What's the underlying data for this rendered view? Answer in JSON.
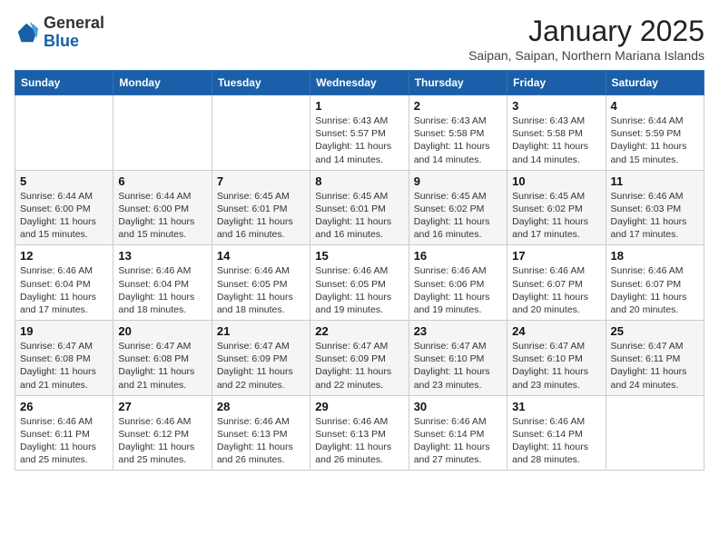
{
  "header": {
    "logo": {
      "general": "General",
      "blue": "Blue"
    },
    "month": "January 2025",
    "location": "Saipan, Saipan, Northern Mariana Islands"
  },
  "weekdays": [
    "Sunday",
    "Monday",
    "Tuesday",
    "Wednesday",
    "Thursday",
    "Friday",
    "Saturday"
  ],
  "weeks": [
    [
      {
        "day": "",
        "sunrise": "",
        "sunset": "",
        "daylight": ""
      },
      {
        "day": "",
        "sunrise": "",
        "sunset": "",
        "daylight": ""
      },
      {
        "day": "",
        "sunrise": "",
        "sunset": "",
        "daylight": ""
      },
      {
        "day": "1",
        "sunrise": "Sunrise: 6:43 AM",
        "sunset": "Sunset: 5:57 PM",
        "daylight": "Daylight: 11 hours and 14 minutes."
      },
      {
        "day": "2",
        "sunrise": "Sunrise: 6:43 AM",
        "sunset": "Sunset: 5:58 PM",
        "daylight": "Daylight: 11 hours and 14 minutes."
      },
      {
        "day": "3",
        "sunrise": "Sunrise: 6:43 AM",
        "sunset": "Sunset: 5:58 PM",
        "daylight": "Daylight: 11 hours and 14 minutes."
      },
      {
        "day": "4",
        "sunrise": "Sunrise: 6:44 AM",
        "sunset": "Sunset: 5:59 PM",
        "daylight": "Daylight: 11 hours and 15 minutes."
      }
    ],
    [
      {
        "day": "5",
        "sunrise": "Sunrise: 6:44 AM",
        "sunset": "Sunset: 6:00 PM",
        "daylight": "Daylight: 11 hours and 15 minutes."
      },
      {
        "day": "6",
        "sunrise": "Sunrise: 6:44 AM",
        "sunset": "Sunset: 6:00 PM",
        "daylight": "Daylight: 11 hours and 15 minutes."
      },
      {
        "day": "7",
        "sunrise": "Sunrise: 6:45 AM",
        "sunset": "Sunset: 6:01 PM",
        "daylight": "Daylight: 11 hours and 16 minutes."
      },
      {
        "day": "8",
        "sunrise": "Sunrise: 6:45 AM",
        "sunset": "Sunset: 6:01 PM",
        "daylight": "Daylight: 11 hours and 16 minutes."
      },
      {
        "day": "9",
        "sunrise": "Sunrise: 6:45 AM",
        "sunset": "Sunset: 6:02 PM",
        "daylight": "Daylight: 11 hours and 16 minutes."
      },
      {
        "day": "10",
        "sunrise": "Sunrise: 6:45 AM",
        "sunset": "Sunset: 6:02 PM",
        "daylight": "Daylight: 11 hours and 17 minutes."
      },
      {
        "day": "11",
        "sunrise": "Sunrise: 6:46 AM",
        "sunset": "Sunset: 6:03 PM",
        "daylight": "Daylight: 11 hours and 17 minutes."
      }
    ],
    [
      {
        "day": "12",
        "sunrise": "Sunrise: 6:46 AM",
        "sunset": "Sunset: 6:04 PM",
        "daylight": "Daylight: 11 hours and 17 minutes."
      },
      {
        "day": "13",
        "sunrise": "Sunrise: 6:46 AM",
        "sunset": "Sunset: 6:04 PM",
        "daylight": "Daylight: 11 hours and 18 minutes."
      },
      {
        "day": "14",
        "sunrise": "Sunrise: 6:46 AM",
        "sunset": "Sunset: 6:05 PM",
        "daylight": "Daylight: 11 hours and 18 minutes."
      },
      {
        "day": "15",
        "sunrise": "Sunrise: 6:46 AM",
        "sunset": "Sunset: 6:05 PM",
        "daylight": "Daylight: 11 hours and 19 minutes."
      },
      {
        "day": "16",
        "sunrise": "Sunrise: 6:46 AM",
        "sunset": "Sunset: 6:06 PM",
        "daylight": "Daylight: 11 hours and 19 minutes."
      },
      {
        "day": "17",
        "sunrise": "Sunrise: 6:46 AM",
        "sunset": "Sunset: 6:07 PM",
        "daylight": "Daylight: 11 hours and 20 minutes."
      },
      {
        "day": "18",
        "sunrise": "Sunrise: 6:46 AM",
        "sunset": "Sunset: 6:07 PM",
        "daylight": "Daylight: 11 hours and 20 minutes."
      }
    ],
    [
      {
        "day": "19",
        "sunrise": "Sunrise: 6:47 AM",
        "sunset": "Sunset: 6:08 PM",
        "daylight": "Daylight: 11 hours and 21 minutes."
      },
      {
        "day": "20",
        "sunrise": "Sunrise: 6:47 AM",
        "sunset": "Sunset: 6:08 PM",
        "daylight": "Daylight: 11 hours and 21 minutes."
      },
      {
        "day": "21",
        "sunrise": "Sunrise: 6:47 AM",
        "sunset": "Sunset: 6:09 PM",
        "daylight": "Daylight: 11 hours and 22 minutes."
      },
      {
        "day": "22",
        "sunrise": "Sunrise: 6:47 AM",
        "sunset": "Sunset: 6:09 PM",
        "daylight": "Daylight: 11 hours and 22 minutes."
      },
      {
        "day": "23",
        "sunrise": "Sunrise: 6:47 AM",
        "sunset": "Sunset: 6:10 PM",
        "daylight": "Daylight: 11 hours and 23 minutes."
      },
      {
        "day": "24",
        "sunrise": "Sunrise: 6:47 AM",
        "sunset": "Sunset: 6:10 PM",
        "daylight": "Daylight: 11 hours and 23 minutes."
      },
      {
        "day": "25",
        "sunrise": "Sunrise: 6:47 AM",
        "sunset": "Sunset: 6:11 PM",
        "daylight": "Daylight: 11 hours and 24 minutes."
      }
    ],
    [
      {
        "day": "26",
        "sunrise": "Sunrise: 6:46 AM",
        "sunset": "Sunset: 6:11 PM",
        "daylight": "Daylight: 11 hours and 25 minutes."
      },
      {
        "day": "27",
        "sunrise": "Sunrise: 6:46 AM",
        "sunset": "Sunset: 6:12 PM",
        "daylight": "Daylight: 11 hours and 25 minutes."
      },
      {
        "day": "28",
        "sunrise": "Sunrise: 6:46 AM",
        "sunset": "Sunset: 6:13 PM",
        "daylight": "Daylight: 11 hours and 26 minutes."
      },
      {
        "day": "29",
        "sunrise": "Sunrise: 6:46 AM",
        "sunset": "Sunset: 6:13 PM",
        "daylight": "Daylight: 11 hours and 26 minutes."
      },
      {
        "day": "30",
        "sunrise": "Sunrise: 6:46 AM",
        "sunset": "Sunset: 6:14 PM",
        "daylight": "Daylight: 11 hours and 27 minutes."
      },
      {
        "day": "31",
        "sunrise": "Sunrise: 6:46 AM",
        "sunset": "Sunset: 6:14 PM",
        "daylight": "Daylight: 11 hours and 28 minutes."
      },
      {
        "day": "",
        "sunrise": "",
        "sunset": "",
        "daylight": ""
      }
    ]
  ]
}
